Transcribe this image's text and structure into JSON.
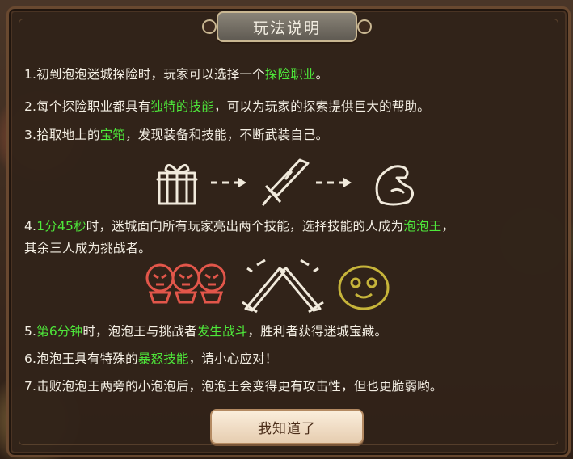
{
  "dialog": {
    "title": "玩法说明",
    "confirm_label": "我知道了"
  },
  "rules": [
    {
      "segments": [
        {
          "t": "1.初到泡泡迷城探险时，玩家可以选择一个"
        },
        {
          "t": "探险职业",
          "hl": true
        },
        {
          "t": "。"
        }
      ]
    },
    {
      "segments": [
        {
          "t": "2.每个探险职业都具有"
        },
        {
          "t": "独特的技能",
          "hl": true
        },
        {
          "t": "，可以为玩家的探索提供巨大的帮助。"
        }
      ]
    },
    {
      "segments": [
        {
          "t": "3.拾取地上的"
        },
        {
          "t": "宝箱",
          "hl": true
        },
        {
          "t": "，发现装备和技能，不断武装自己。"
        }
      ]
    },
    {
      "segments": [
        {
          "t": "4."
        },
        {
          "t": "1分45秒",
          "hl": true
        },
        {
          "t": "时，迷城面向所有玩家亮出两个技能，选择技能的人成为"
        },
        {
          "t": "泡泡王",
          "hl": true
        },
        {
          "t": "，"
        }
      ]
    },
    {
      "segments": [
        {
          "t": "其余三人成为挑战者。"
        }
      ]
    },
    {
      "segments": [
        {
          "t": "5."
        },
        {
          "t": "第6分钟",
          "hl": true
        },
        {
          "t": "时，泡泡王与挑战者"
        },
        {
          "t": "发生战斗",
          "hl": true
        },
        {
          "t": "，胜利者获得迷城宝藏。"
        }
      ]
    },
    {
      "segments": [
        {
          "t": "6.泡泡王具有特殊的"
        },
        {
          "t": "暴怒技能",
          "hl": true
        },
        {
          "t": "，请小心应对！"
        }
      ]
    },
    {
      "segments": [
        {
          "t": "7.击败泡泡王两旁的小泡泡后，泡泡王会变得更有攻击性，但也更脆弱哟。"
        }
      ]
    }
  ],
  "colors": {
    "highlight": "#4ee83a",
    "text": "#f4efe4",
    "panel": "#312319"
  },
  "icons": [
    "gift-box-icon",
    "arrow-right-icon",
    "sword-icon",
    "arrow-right-icon",
    "muscle-arm-icon",
    "angry-bubbles-icon",
    "crossed-swords-icon",
    "smiley-bubble-icon"
  ]
}
